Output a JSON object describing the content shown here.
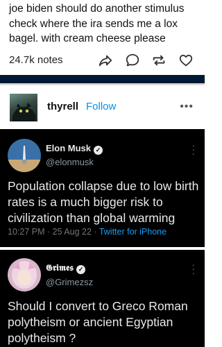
{
  "post": {
    "text": "joe biden should do another stimulus check where the ira sends me a lox bagel. with cream cheese please",
    "notes": "24.7k notes"
  },
  "actions": {
    "share_icon": "share-arrow-icon",
    "reply_icon": "reply-bubble-icon",
    "reblog_icon": "reblog-icon",
    "like_icon": "heart-icon"
  },
  "reblog": {
    "username": "thyrell",
    "follow_label": "Follow",
    "more_label": "•••"
  },
  "tweets": [
    {
      "name": "Elon Musk",
      "handle": "@elonmusk",
      "text": "Population collapse due to low birth rates is a much bigger risk to civilization than global warming",
      "time": "10:27 PM · 25 Aug 22 · ",
      "source": "Twitter for iPhone"
    },
    {
      "name": "𝕲𝖗𝖎𝖒𝖊𝖘",
      "handle": "@Grimezsz",
      "text": "Should I convert to Greco Roman polytheism or ancient Egyptian polytheism ?"
    }
  ],
  "colors": {
    "tumblr_navy": "#001935",
    "follow_blue": "#0092e6",
    "twitter_bg": "#000000",
    "twitter_link": "#1d9bf0"
  }
}
